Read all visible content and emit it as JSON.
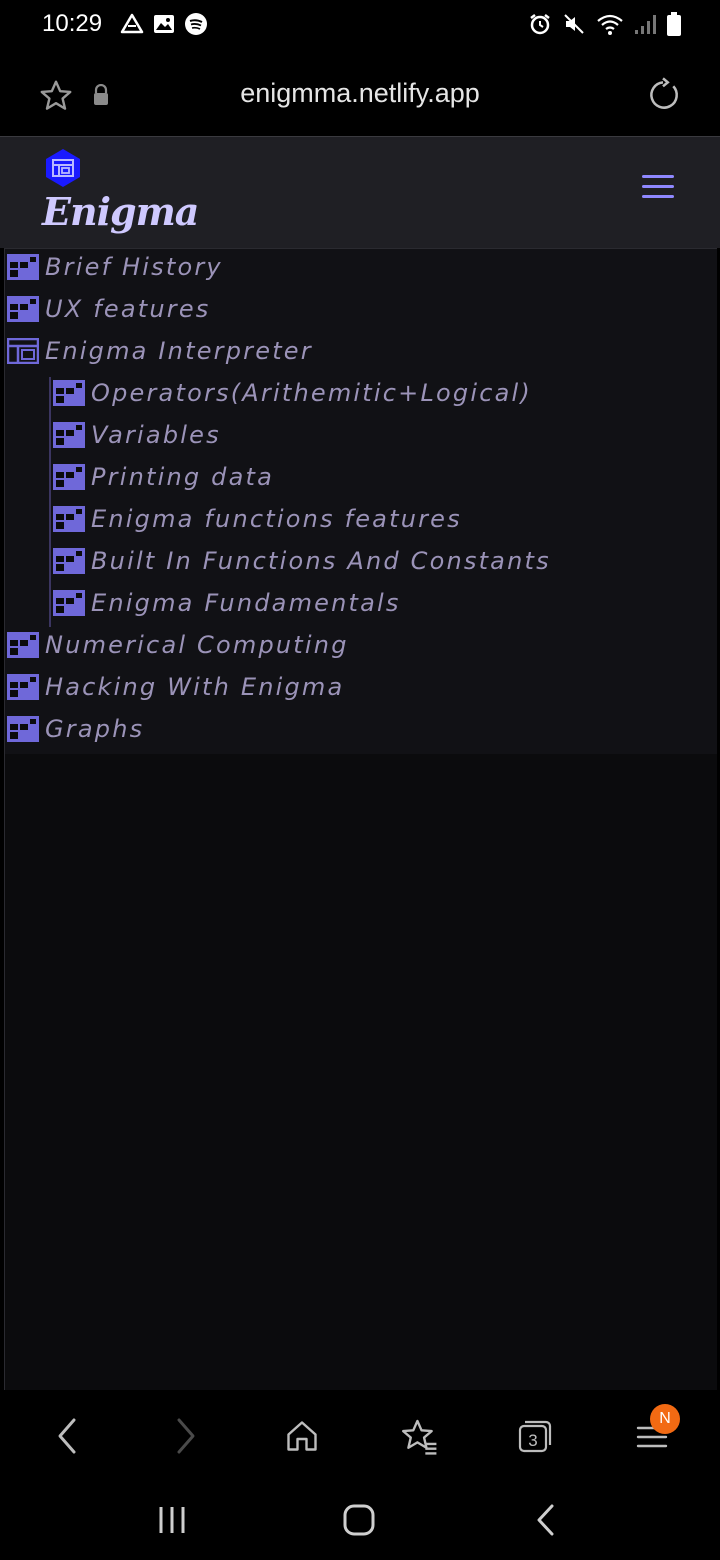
{
  "status_bar": {
    "time": "10:29",
    "left_icons": [
      "drive-icon",
      "image-icon",
      "spotify-icon"
    ],
    "right_icons": [
      "alarm-icon",
      "mute-icon",
      "wifi-icon",
      "signal-icon",
      "battery-icon"
    ]
  },
  "browser": {
    "url": "enigmma.netlify.app",
    "tab_count": "3",
    "menu_badge": "N"
  },
  "site": {
    "brand": "Enigma",
    "accent_color": "#8f88ff",
    "logo_color": "#1a1aff"
  },
  "tree": {
    "items": [
      {
        "label": "Brief History",
        "level": 0,
        "expanded": false
      },
      {
        "label": "UX features",
        "level": 0,
        "expanded": false
      },
      {
        "label": "Enigma Interpreter",
        "level": 0,
        "expanded": true
      },
      {
        "label": "Operators(Arithemitic+Logical)",
        "level": 1,
        "expanded": false
      },
      {
        "label": "Variables",
        "level": 1,
        "expanded": false
      },
      {
        "label": "Printing data",
        "level": 1,
        "expanded": false
      },
      {
        "label": "Enigma functions features",
        "level": 1,
        "expanded": false
      },
      {
        "label": "Built In Functions And Constants",
        "level": 1,
        "expanded": false
      },
      {
        "label": "Enigma Fundamentals",
        "level": 1,
        "expanded": false
      },
      {
        "label": "Numerical Computing",
        "level": 0,
        "expanded": false
      },
      {
        "label": "Hacking With Enigma",
        "level": 0,
        "expanded": false
      },
      {
        "label": "Graphs",
        "level": 0,
        "expanded": false
      }
    ]
  }
}
